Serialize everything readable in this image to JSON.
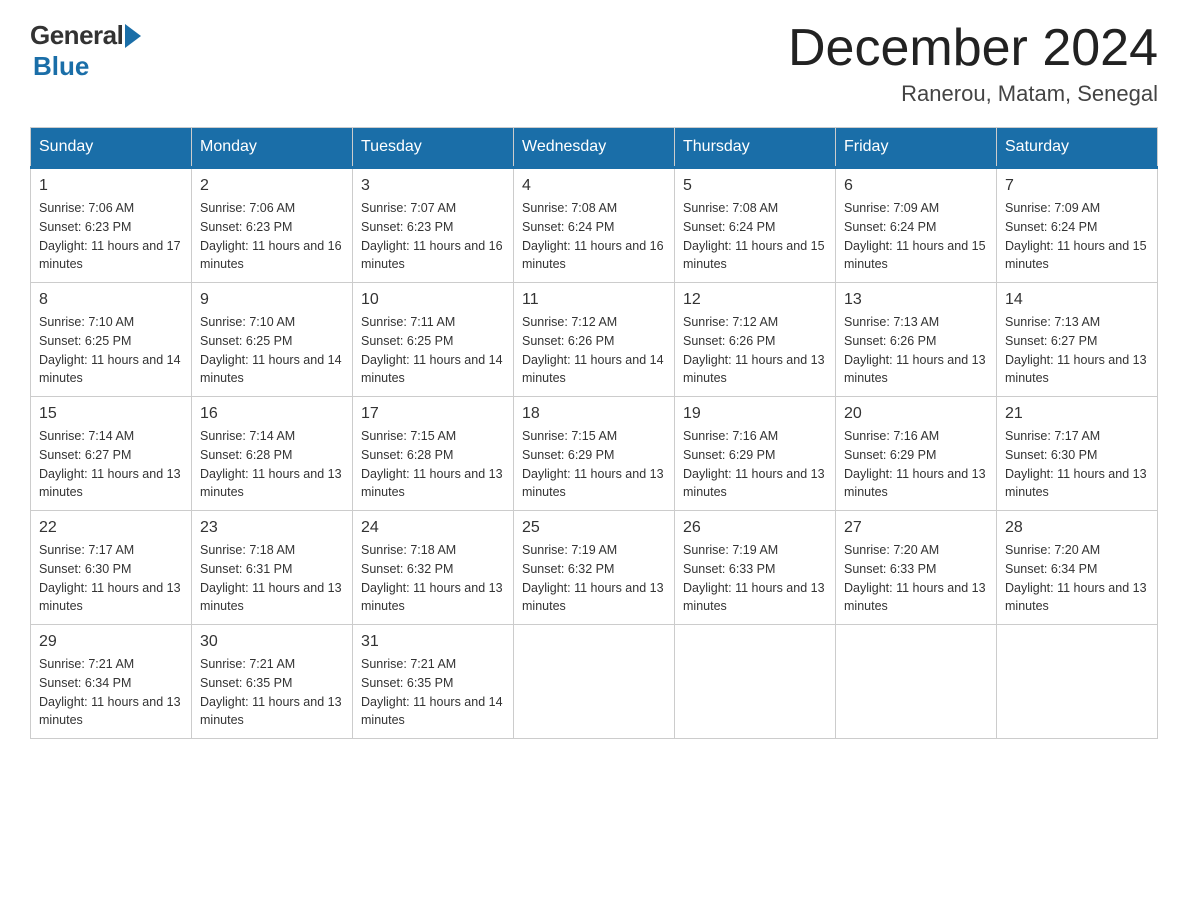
{
  "header": {
    "logo_general": "General",
    "logo_blue": "Blue",
    "month_title": "December 2024",
    "location": "Ranerou, Matam, Senegal"
  },
  "days_of_week": [
    "Sunday",
    "Monday",
    "Tuesday",
    "Wednesday",
    "Thursday",
    "Friday",
    "Saturday"
  ],
  "weeks": [
    [
      {
        "num": "1",
        "sunrise": "7:06 AM",
        "sunset": "6:23 PM",
        "daylight": "11 hours and 17 minutes."
      },
      {
        "num": "2",
        "sunrise": "7:06 AM",
        "sunset": "6:23 PM",
        "daylight": "11 hours and 16 minutes."
      },
      {
        "num": "3",
        "sunrise": "7:07 AM",
        "sunset": "6:23 PM",
        "daylight": "11 hours and 16 minutes."
      },
      {
        "num": "4",
        "sunrise": "7:08 AM",
        "sunset": "6:24 PM",
        "daylight": "11 hours and 16 minutes."
      },
      {
        "num": "5",
        "sunrise": "7:08 AM",
        "sunset": "6:24 PM",
        "daylight": "11 hours and 15 minutes."
      },
      {
        "num": "6",
        "sunrise": "7:09 AM",
        "sunset": "6:24 PM",
        "daylight": "11 hours and 15 minutes."
      },
      {
        "num": "7",
        "sunrise": "7:09 AM",
        "sunset": "6:24 PM",
        "daylight": "11 hours and 15 minutes."
      }
    ],
    [
      {
        "num": "8",
        "sunrise": "7:10 AM",
        "sunset": "6:25 PM",
        "daylight": "11 hours and 14 minutes."
      },
      {
        "num": "9",
        "sunrise": "7:10 AM",
        "sunset": "6:25 PM",
        "daylight": "11 hours and 14 minutes."
      },
      {
        "num": "10",
        "sunrise": "7:11 AM",
        "sunset": "6:25 PM",
        "daylight": "11 hours and 14 minutes."
      },
      {
        "num": "11",
        "sunrise": "7:12 AM",
        "sunset": "6:26 PM",
        "daylight": "11 hours and 14 minutes."
      },
      {
        "num": "12",
        "sunrise": "7:12 AM",
        "sunset": "6:26 PM",
        "daylight": "11 hours and 13 minutes."
      },
      {
        "num": "13",
        "sunrise": "7:13 AM",
        "sunset": "6:26 PM",
        "daylight": "11 hours and 13 minutes."
      },
      {
        "num": "14",
        "sunrise": "7:13 AM",
        "sunset": "6:27 PM",
        "daylight": "11 hours and 13 minutes."
      }
    ],
    [
      {
        "num": "15",
        "sunrise": "7:14 AM",
        "sunset": "6:27 PM",
        "daylight": "11 hours and 13 minutes."
      },
      {
        "num": "16",
        "sunrise": "7:14 AM",
        "sunset": "6:28 PM",
        "daylight": "11 hours and 13 minutes."
      },
      {
        "num": "17",
        "sunrise": "7:15 AM",
        "sunset": "6:28 PM",
        "daylight": "11 hours and 13 minutes."
      },
      {
        "num": "18",
        "sunrise": "7:15 AM",
        "sunset": "6:29 PM",
        "daylight": "11 hours and 13 minutes."
      },
      {
        "num": "19",
        "sunrise": "7:16 AM",
        "sunset": "6:29 PM",
        "daylight": "11 hours and 13 minutes."
      },
      {
        "num": "20",
        "sunrise": "7:16 AM",
        "sunset": "6:29 PM",
        "daylight": "11 hours and 13 minutes."
      },
      {
        "num": "21",
        "sunrise": "7:17 AM",
        "sunset": "6:30 PM",
        "daylight": "11 hours and 13 minutes."
      }
    ],
    [
      {
        "num": "22",
        "sunrise": "7:17 AM",
        "sunset": "6:30 PM",
        "daylight": "11 hours and 13 minutes."
      },
      {
        "num": "23",
        "sunrise": "7:18 AM",
        "sunset": "6:31 PM",
        "daylight": "11 hours and 13 minutes."
      },
      {
        "num": "24",
        "sunrise": "7:18 AM",
        "sunset": "6:32 PM",
        "daylight": "11 hours and 13 minutes."
      },
      {
        "num": "25",
        "sunrise": "7:19 AM",
        "sunset": "6:32 PM",
        "daylight": "11 hours and 13 minutes."
      },
      {
        "num": "26",
        "sunrise": "7:19 AM",
        "sunset": "6:33 PM",
        "daylight": "11 hours and 13 minutes."
      },
      {
        "num": "27",
        "sunrise": "7:20 AM",
        "sunset": "6:33 PM",
        "daylight": "11 hours and 13 minutes."
      },
      {
        "num": "28",
        "sunrise": "7:20 AM",
        "sunset": "6:34 PM",
        "daylight": "11 hours and 13 minutes."
      }
    ],
    [
      {
        "num": "29",
        "sunrise": "7:21 AM",
        "sunset": "6:34 PM",
        "daylight": "11 hours and 13 minutes."
      },
      {
        "num": "30",
        "sunrise": "7:21 AM",
        "sunset": "6:35 PM",
        "daylight": "11 hours and 13 minutes."
      },
      {
        "num": "31",
        "sunrise": "7:21 AM",
        "sunset": "6:35 PM",
        "daylight": "11 hours and 14 minutes."
      },
      null,
      null,
      null,
      null
    ]
  ]
}
